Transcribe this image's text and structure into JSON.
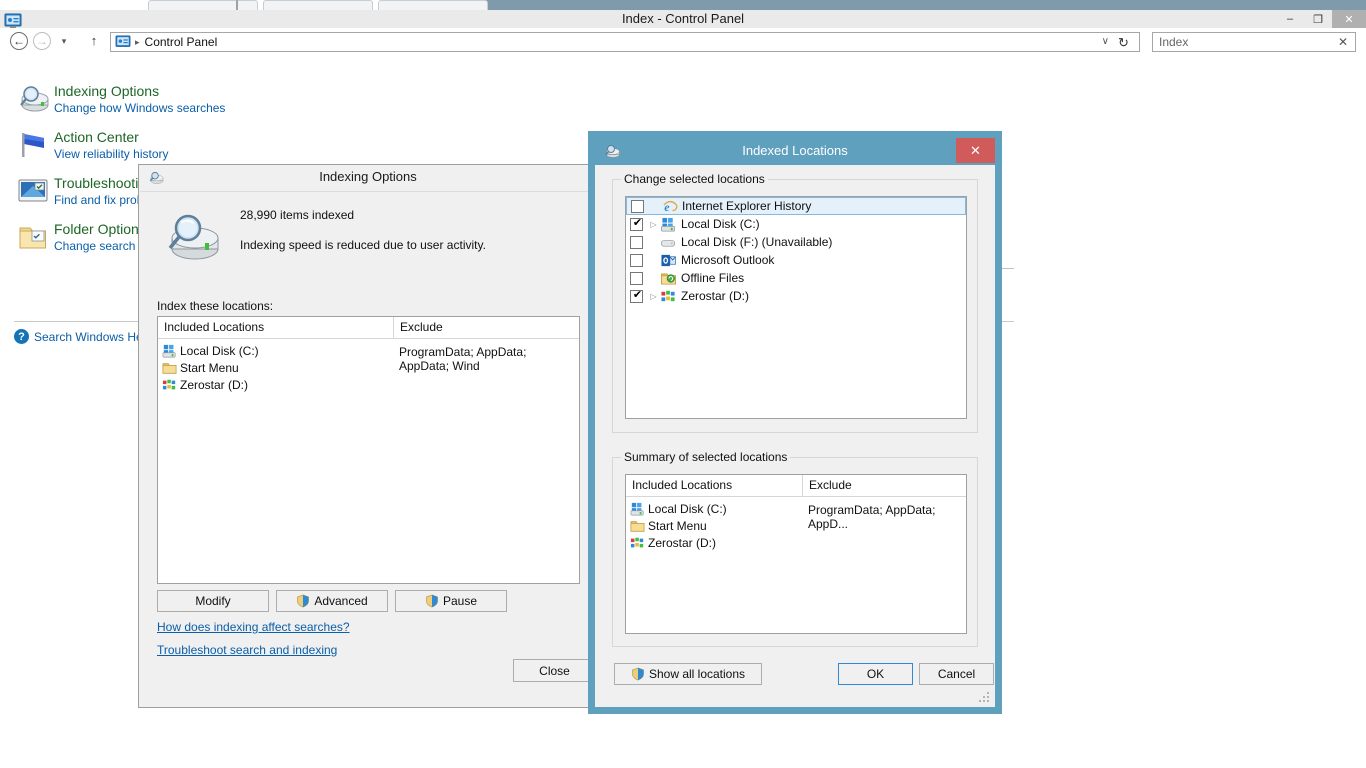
{
  "window": {
    "title": "Index - Control Panel",
    "icon": "control-panel-icon",
    "minimize_label": "–",
    "maximize_label": "❐",
    "close_label": "✕"
  },
  "addressbar": {
    "back_label": "←",
    "forward_label": "→",
    "history_label": "▾",
    "up_label": "↑",
    "path_icon": "control-panel-icon",
    "separator": "▸",
    "path": "Control Panel",
    "dropdown_label": "∨",
    "refresh_label": "↻",
    "search_value": "Index",
    "search_clear_label": "✕"
  },
  "control_panel": {
    "tasks": [
      {
        "icon": "indexing-options-icon",
        "title": "Indexing Options",
        "subtitle": "Change how Windows searches"
      },
      {
        "icon": "action-center-flag-icon",
        "title": "Action Center",
        "subtitle": "View reliability history"
      },
      {
        "icon": "troubleshooting-icon",
        "title": "Troubleshooting",
        "subtitle": "Find and fix problems"
      },
      {
        "icon": "folder-options-icon",
        "title": "Folder Options",
        "subtitle": "Change search options for files and folders"
      }
    ],
    "help_link": {
      "icon": "help-icon",
      "label": "Search Windows Help"
    }
  },
  "indexing_options_dialog": {
    "title": "Indexing Options",
    "icon": "indexing-options-icon",
    "status_icon": "indexing-status-icon",
    "items_indexed": "28,990 items indexed",
    "speed_note": "Indexing speed is reduced due to user activity.",
    "locations_label": "Index these locations:",
    "list": {
      "columns": [
        "Included Locations",
        "Exclude"
      ],
      "rows": [
        {
          "icon": "local-disk-icon",
          "name": "Local Disk (C:)",
          "exclude": "ProgramData; AppData; AppData; Wind"
        },
        {
          "icon": "folder-icon",
          "name": "Start Menu",
          "exclude": ""
        },
        {
          "icon": "zerostar-icon",
          "name": "Zerostar (D:)",
          "exclude": ""
        }
      ]
    },
    "buttons": {
      "modify": "Modify",
      "advanced": "Advanced",
      "pause": "Pause",
      "close": "Close"
    },
    "links": [
      "How does indexing affect searches?",
      "Troubleshoot search and indexing"
    ]
  },
  "indexed_locations_dialog": {
    "title": "Indexed Locations",
    "icon": "indexing-options-icon",
    "close_label": "✕",
    "change_group_title": "Change selected locations",
    "tree": [
      {
        "icon": "internet-explorer-icon",
        "label": "Internet Explorer History",
        "checked": false,
        "expandable": false,
        "selected": true
      },
      {
        "icon": "local-disk-icon",
        "label": "Local Disk (C:)",
        "checked": true,
        "expandable": true,
        "selected": false
      },
      {
        "icon": "unavailable-disk-icon",
        "label": "Local Disk (F:) (Unavailable)",
        "checked": false,
        "expandable": false,
        "selected": false
      },
      {
        "icon": "outlook-icon",
        "label": "Microsoft Outlook",
        "checked": false,
        "expandable": false,
        "selected": false
      },
      {
        "icon": "offline-files-icon",
        "label": "Offline Files",
        "checked": false,
        "expandable": false,
        "selected": false
      },
      {
        "icon": "zerostar-icon",
        "label": "Zerostar (D:)",
        "checked": true,
        "expandable": true,
        "selected": false
      }
    ],
    "summary_group_title": "Summary of selected locations",
    "summary": {
      "columns": [
        "Included Locations",
        "Exclude"
      ],
      "rows": [
        {
          "icon": "local-disk-icon",
          "name": "Local Disk (C:)",
          "exclude": "ProgramData; AppData; AppD..."
        },
        {
          "icon": "folder-icon",
          "name": "Start Menu",
          "exclude": ""
        },
        {
          "icon": "zerostar-icon",
          "name": "Zerostar (D:)",
          "exclude": ""
        }
      ]
    },
    "buttons": {
      "show_all": "Show all locations",
      "ok": "OK",
      "cancel": "Cancel"
    }
  },
  "colors": {
    "dialog_accent": "#5fa0bf",
    "close_red": "#d15b5b",
    "link_blue": "#0b5ea8",
    "heading_green": "#1d6625",
    "selection_blue": "#e4f0fa",
    "default_button_border": "#2e8ad6"
  }
}
